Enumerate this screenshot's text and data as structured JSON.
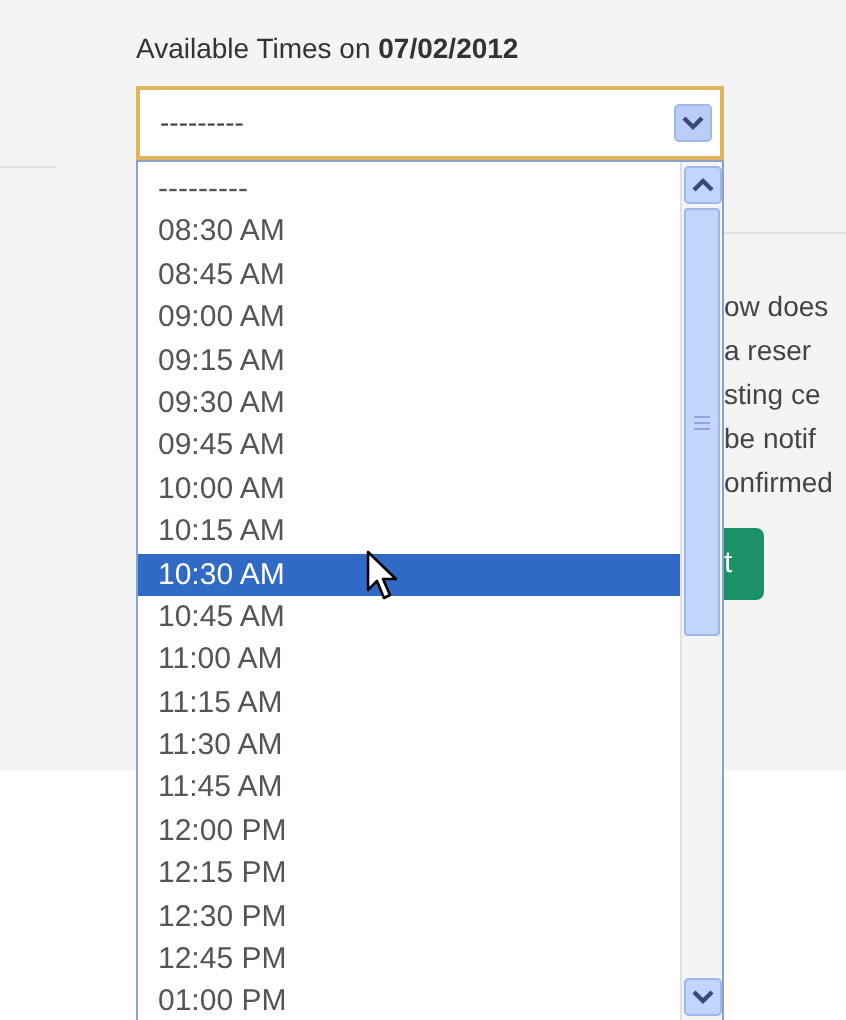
{
  "header": {
    "label": "Available Times on **07/02/2012**"
  },
  "select": {
    "value": "---------",
    "expanded": true
  },
  "options": [
    {
      "label": "---------",
      "selected": false
    },
    {
      "label": "08:30 AM",
      "selected": false
    },
    {
      "label": "08:45 AM",
      "selected": false
    },
    {
      "label": "09:00 AM",
      "selected": false
    },
    {
      "label": "09:15 AM",
      "selected": false
    },
    {
      "label": "09:30 AM",
      "selected": false
    },
    {
      "label": "09:45 AM",
      "selected": false
    },
    {
      "label": "10:00 AM",
      "selected": false
    },
    {
      "label": "10:15 AM",
      "selected": false
    },
    {
      "label": "10:30 AM",
      "selected": true
    },
    {
      "label": "10:45 AM",
      "selected": false
    },
    {
      "label": "11:00 AM",
      "selected": false
    },
    {
      "label": "11:15 AM",
      "selected": false
    },
    {
      "label": "11:30 AM",
      "selected": false
    },
    {
      "label": "11:45 AM",
      "selected": false
    },
    {
      "label": "12:00 PM",
      "selected": false
    },
    {
      "label": "12:15 PM",
      "selected": false
    },
    {
      "label": "12:30 PM",
      "selected": false
    },
    {
      "label": "12:45 PM",
      "selected": false
    },
    {
      "label": "01:00 PM",
      "selected": false
    }
  ],
  "background_text": [
    "ow does",
    "a reser",
    "sting ce",
    "be notif",
    "onfirmed"
  ],
  "background_button": {
    "label": "t"
  }
}
